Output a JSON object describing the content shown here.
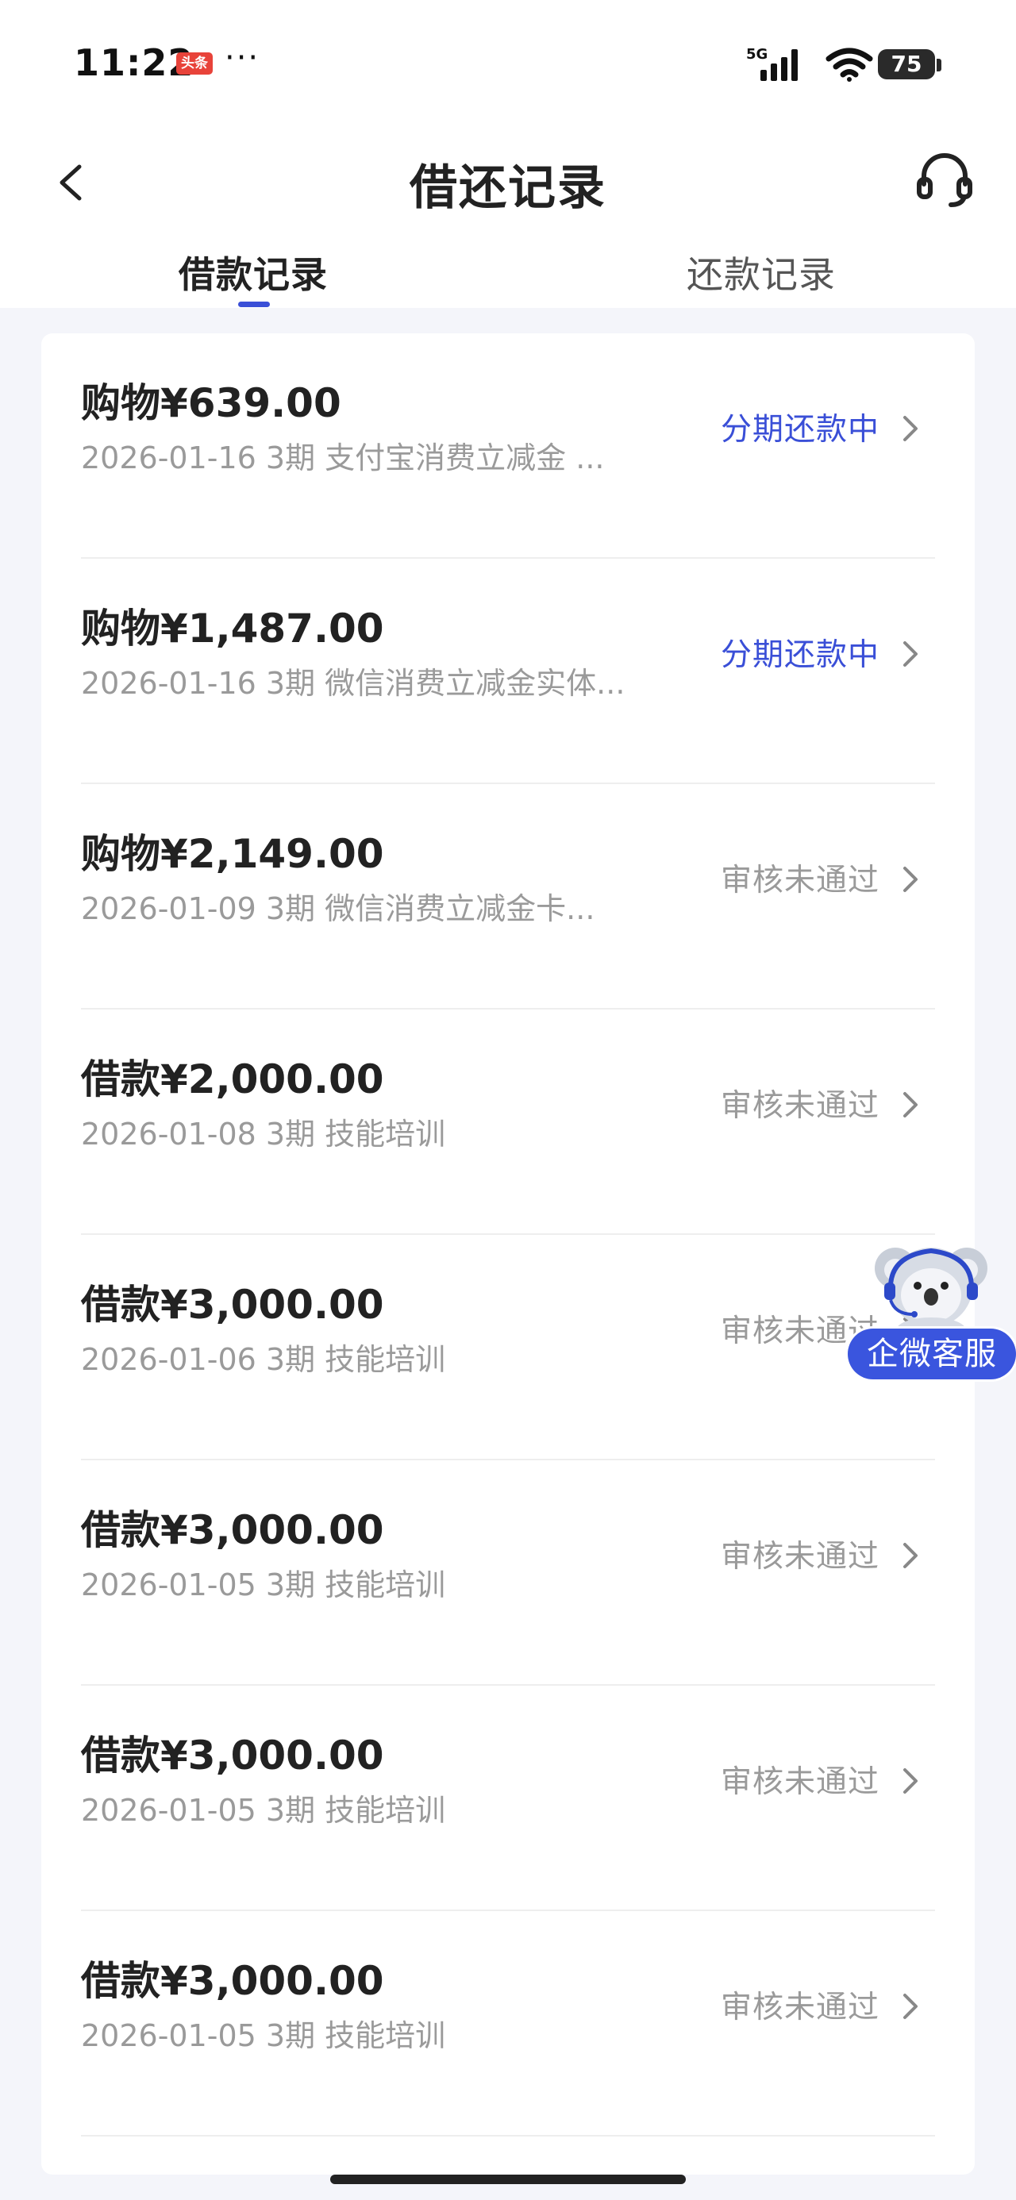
{
  "status_bar": {
    "time": "11:22",
    "news_badge": "头条",
    "more": "···",
    "network": "5G",
    "battery": "75"
  },
  "header": {
    "title": "借还记录",
    "back_icon": "chevron-left-icon",
    "service_icon": "headset-icon"
  },
  "tabs": [
    {
      "label": "借款记录",
      "active": true
    },
    {
      "label": "还款记录",
      "active": false
    }
  ],
  "records": [
    {
      "title": "购物¥639.00",
      "sub": "2026-01-16 3期  支付宝消费立减金 ...",
      "status": "分期还款中",
      "active": true
    },
    {
      "title": "购物¥1,487.00",
      "sub": "2026-01-16 3期  微信消费立减金实体...",
      "status": "分期还款中",
      "active": true
    },
    {
      "title": "购物¥2,149.00",
      "sub": "2026-01-09 3期  微信消费立减金卡...",
      "status": "审核未通过",
      "active": false
    },
    {
      "title": "借款¥2,000.00",
      "sub": "2026-01-08 3期  技能培训",
      "status": "审核未通过",
      "active": false
    },
    {
      "title": "借款¥3,000.00",
      "sub": "2026-01-06 3期  技能培训",
      "status": "审核未通过",
      "active": false
    },
    {
      "title": "借款¥3,000.00",
      "sub": "2026-01-05 3期  技能培训",
      "status": "审核未通过",
      "active": false
    },
    {
      "title": "借款¥3,000.00",
      "sub": "2026-01-05 3期  技能培训",
      "status": "审核未通过",
      "active": false
    },
    {
      "title": "借款¥3,000.00",
      "sub": "2026-01-05 3期  技能培训",
      "status": "审核未通过",
      "active": false
    }
  ],
  "float_service": {
    "label": "企微客服",
    "icon": "koala-avatar-icon"
  },
  "colors": {
    "accent": "#3a4fd7",
    "muted": "#9a9a9a",
    "background": "#f4f5fa"
  }
}
